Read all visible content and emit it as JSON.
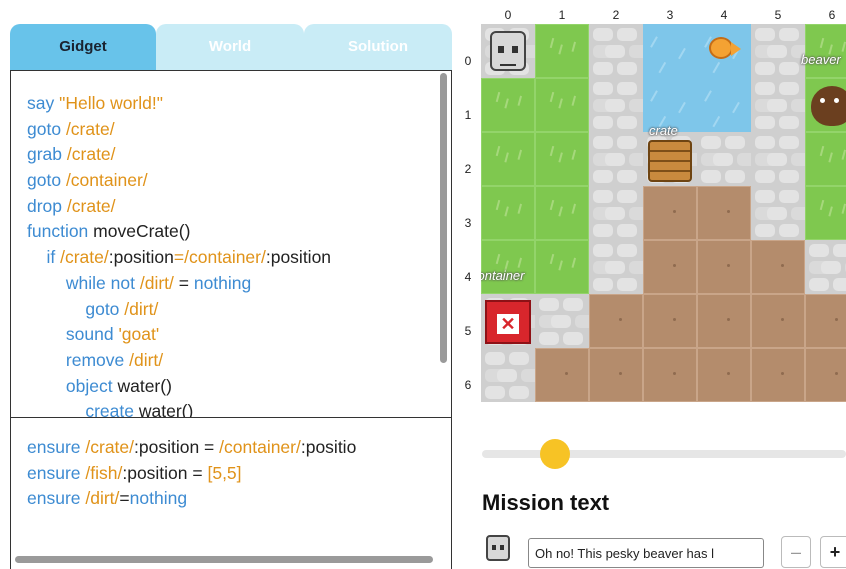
{
  "tabs": [
    {
      "label": "Gidget",
      "active": true
    },
    {
      "label": "World",
      "active": false
    },
    {
      "label": "Solution",
      "active": false
    }
  ],
  "code_lines": [
    [
      [
        "kw",
        "say "
      ],
      [
        "str",
        "\"Hello world!\""
      ]
    ],
    [
      [
        "kw",
        "goto "
      ],
      [
        "str",
        "/crate/"
      ]
    ],
    [
      [
        "kw",
        "grab "
      ],
      [
        "str",
        "/crate/"
      ]
    ],
    [
      [
        "kw",
        "goto "
      ],
      [
        "str",
        "/container/"
      ]
    ],
    [
      [
        "kw",
        "drop "
      ],
      [
        "str",
        "/crate/"
      ]
    ],
    [
      [
        "kw",
        "function "
      ],
      [
        "plain",
        "moveCrate()"
      ]
    ],
    [
      [
        "plain",
        "    "
      ],
      [
        "kw",
        "if "
      ],
      [
        "str",
        "/crate/"
      ],
      [
        "plain",
        ":position"
      ],
      [
        "str",
        "="
      ],
      [
        "str",
        "/container/"
      ],
      [
        "plain",
        ":position"
      ]
    ],
    [
      [
        "plain",
        "        "
      ],
      [
        "kw",
        "while not "
      ],
      [
        "str",
        "/dirt/"
      ],
      [
        "plain",
        " = "
      ],
      [
        "kw",
        "nothing"
      ]
    ],
    [
      [
        "plain",
        "            "
      ],
      [
        "kw",
        "goto "
      ],
      [
        "str",
        "/dirt/"
      ]
    ],
    [
      [
        "plain",
        "        "
      ],
      [
        "kw",
        "sound "
      ],
      [
        "str",
        "'goat'"
      ]
    ],
    [
      [
        "plain",
        "        "
      ],
      [
        "kw",
        "remove "
      ],
      [
        "str",
        "/dirt/"
      ]
    ],
    [
      [
        "plain",
        "        "
      ],
      [
        "kw",
        "object "
      ],
      [
        "plain",
        "water()"
      ]
    ],
    [
      [
        "plain",
        "            "
      ],
      [
        "kw",
        "create "
      ],
      [
        "plain",
        "water()"
      ]
    ]
  ],
  "assertion_lines": [
    [
      [
        "kw",
        "ensure "
      ],
      [
        "str",
        "/crate/"
      ],
      [
        "plain",
        ":position = "
      ],
      [
        "str",
        "/container/"
      ],
      [
        "plain",
        ":positio"
      ]
    ],
    [
      [
        "kw",
        "ensure "
      ],
      [
        "str",
        "/fish/"
      ],
      [
        "plain",
        ":position = "
      ],
      [
        "str",
        "[5,5]"
      ]
    ],
    [
      [
        "kw",
        "ensure "
      ],
      [
        "str",
        "/dirt/"
      ],
      [
        "plain",
        "="
      ],
      [
        "kw",
        "nothing"
      ]
    ]
  ],
  "world": {
    "columns": [
      "0",
      "1",
      "2",
      "3",
      "4",
      "5",
      "6"
    ],
    "rows": [
      "0",
      "1",
      "2",
      "3",
      "4",
      "5",
      "6"
    ],
    "tiles": [
      [
        "stone",
        "grass",
        "stone",
        "water",
        "water",
        "stone",
        "grass"
      ],
      [
        "grass",
        "grass",
        "stone",
        "water",
        "water",
        "stone",
        "grass"
      ],
      [
        "grass",
        "grass",
        "stone",
        "stone",
        "stone",
        "stone",
        "grass"
      ],
      [
        "grass",
        "grass",
        "stone",
        "dirt",
        "dirt",
        "stone",
        "grass"
      ],
      [
        "grass",
        "grass",
        "stone",
        "dirt",
        "dirt",
        "dirt",
        "stone"
      ],
      [
        "stone",
        "stone",
        "dirt",
        "dirt",
        "dirt",
        "dirt",
        "dirt"
      ],
      [
        "stone",
        "dirt",
        "dirt",
        "dirt",
        "dirt",
        "dirt",
        "dirt"
      ]
    ],
    "objects": [
      {
        "type": "gidget",
        "icon": "gidget-robot-icon",
        "row": 0,
        "col": 0,
        "label": ""
      },
      {
        "type": "fish",
        "icon": "fish-icon",
        "row": 0,
        "col": 4,
        "label": ""
      },
      {
        "type": "beaver",
        "icon": "beaver-icon",
        "row": 1,
        "col": 6,
        "label": "beaver"
      },
      {
        "type": "crate",
        "icon": "crate-icon",
        "row": 2,
        "col": 3,
        "label": "crate"
      },
      {
        "type": "container",
        "icon": "container-icon",
        "row": 5,
        "col": 0,
        "label": "container"
      }
    ]
  },
  "slider": {
    "value": 0.2
  },
  "mission": {
    "title": "Mission text",
    "text_value": "Oh no! This pesky beaver has l",
    "minus_label": "–",
    "plus_label": "+"
  },
  "colors": {
    "tab_active": "#68c3ea",
    "tab_inactive": "#c9ecf6",
    "keyword": "#3d8bd2",
    "string": "#e0931a",
    "slider_thumb": "#f7c325"
  }
}
